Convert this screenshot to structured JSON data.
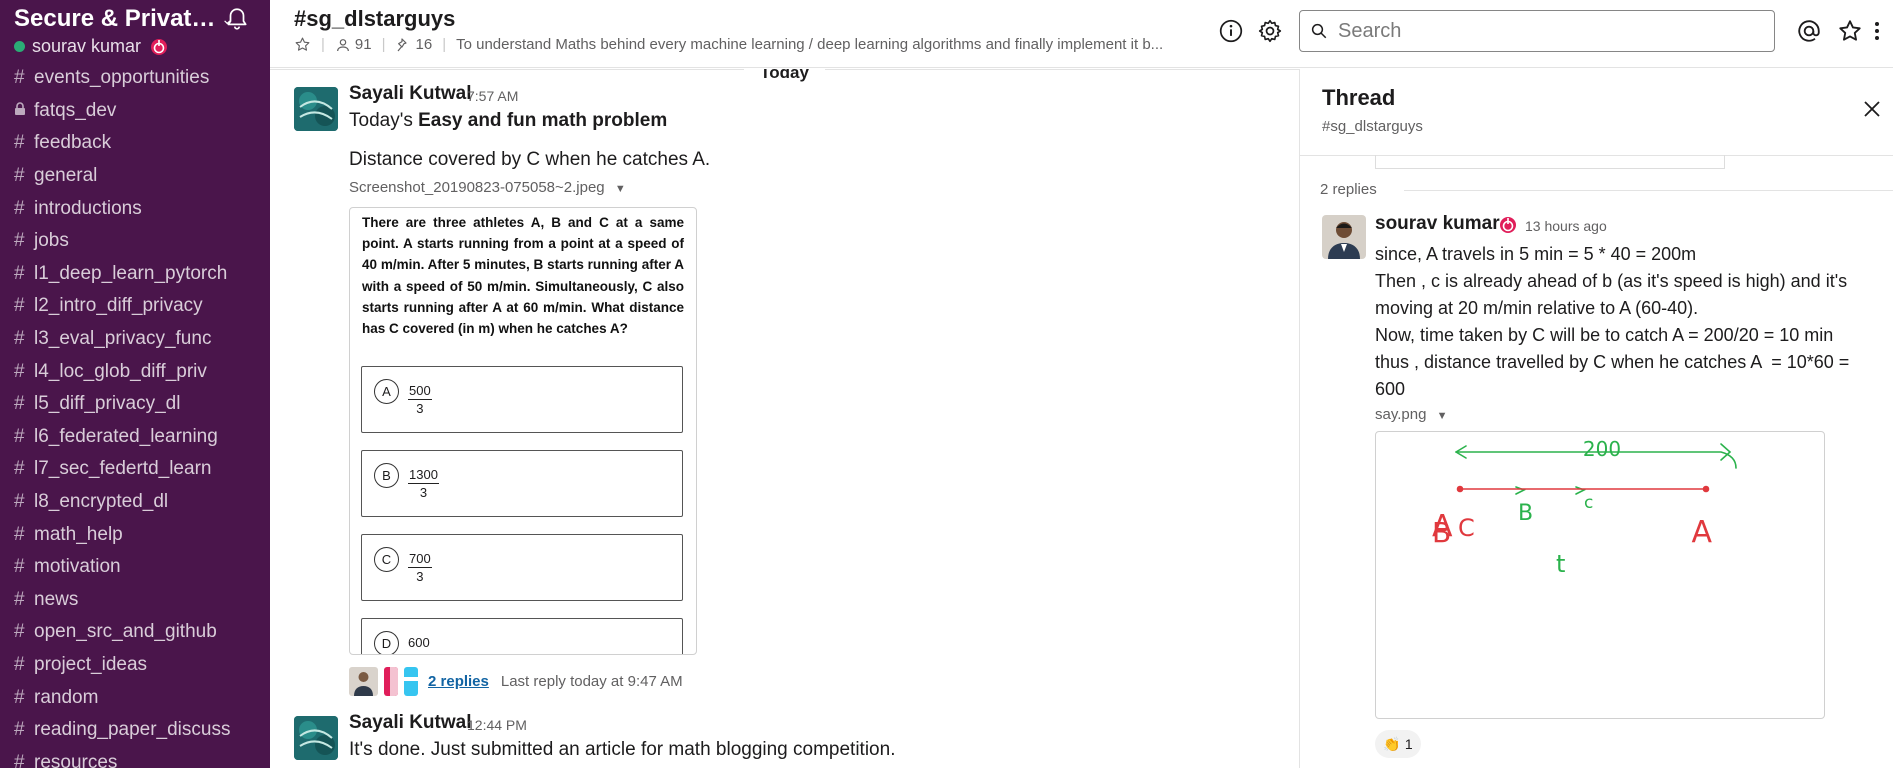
{
  "workspace": {
    "name": "Secure & Privat…",
    "user": "sourav kumar"
  },
  "channels": [
    {
      "prefix": "#",
      "name": "events_opportunities"
    },
    {
      "prefix": "lock",
      "name": "fatqs_dev"
    },
    {
      "prefix": "#",
      "name": "feedback"
    },
    {
      "prefix": "#",
      "name": "general"
    },
    {
      "prefix": "#",
      "name": "introductions"
    },
    {
      "prefix": "#",
      "name": "jobs"
    },
    {
      "prefix": "#",
      "name": "l1_deep_learn_pytorch"
    },
    {
      "prefix": "#",
      "name": "l2_intro_diff_privacy"
    },
    {
      "prefix": "#",
      "name": "l3_eval_privacy_func"
    },
    {
      "prefix": "#",
      "name": "l4_loc_glob_diff_priv"
    },
    {
      "prefix": "#",
      "name": "l5_diff_privacy_dl"
    },
    {
      "prefix": "#",
      "name": "l6_federated_learning"
    },
    {
      "prefix": "#",
      "name": "l7_sec_federtd_learn"
    },
    {
      "prefix": "#",
      "name": "l8_encrypted_dl"
    },
    {
      "prefix": "#",
      "name": "math_help"
    },
    {
      "prefix": "#",
      "name": "motivation"
    },
    {
      "prefix": "#",
      "name": "news"
    },
    {
      "prefix": "#",
      "name": "open_src_and_github"
    },
    {
      "prefix": "#",
      "name": "project_ideas"
    },
    {
      "prefix": "#",
      "name": "random"
    },
    {
      "prefix": "#",
      "name": "reading_paper_discuss"
    },
    {
      "prefix": "#",
      "name": "resources"
    }
  ],
  "header": {
    "channel": "#sg_dlstarguys",
    "members": "91",
    "pinned": "16",
    "topic": "To understand Maths behind every machine learning / deep learning algorithms and finally implement it b...",
    "search_placeholder": "Search"
  },
  "messages": {
    "day_divider": "Today",
    "first": {
      "author": "Sayali Kutwal",
      "time": "7:57 AM",
      "line1_prefix": "Today's ",
      "line1_bold": "Easy and fun math problem",
      "line2": "Distance covered by C when he catches A.",
      "file_name": "Screenshot_20190823-075058~2.jpeg",
      "question": "There are three athletes A, B and C at a same point. A starts running from a point at a speed of 40 m/min. After 5 minutes, B starts running after A with a speed of 50 m/min. Simultaneously, C also starts running after A at 60 m/min. What distance has C covered (in m) when he catches A?",
      "options": [
        {
          "letter": "A",
          "num": "500",
          "den": "3"
        },
        {
          "letter": "B",
          "num": "1300",
          "den": "3"
        },
        {
          "letter": "C",
          "num": "700",
          "den": "3"
        },
        {
          "letter": "D",
          "value": "600"
        }
      ],
      "replies_link": "2 replies",
      "last_reply": "Last reply today at 9:47 AM"
    },
    "second": {
      "author": "Sayali Kutwal",
      "time": "12:44 PM",
      "text": "It's done. Just submitted an article for math blogging competition."
    }
  },
  "thread": {
    "title": "Thread",
    "channel": "#sg_dlstarguys",
    "replies_count": "2 replies",
    "reply": {
      "author": "sourav kumar",
      "time": "13 hours ago",
      "lines": [
        "since, A travels in 5 min = 5 * 40 = 200m",
        "Then , c is already ahead of b (as it's speed is high) and it's moving at 20 m/min relative to A (60-40).",
        "Now, time taken by C will be to catch A = 200/20 = 10 min",
        "thus , distance travelled by C when he catches A  = 10*60 = 600"
      ],
      "file_name": "say.png",
      "sketch_labels": [
        "200",
        "B",
        "c",
        "A",
        "B",
        "C",
        "A",
        "t"
      ],
      "reaction_count": "1"
    }
  },
  "colors": {
    "sidebar": "#4a154b",
    "link": "#1264a3",
    "presence": "#2bac76"
  }
}
